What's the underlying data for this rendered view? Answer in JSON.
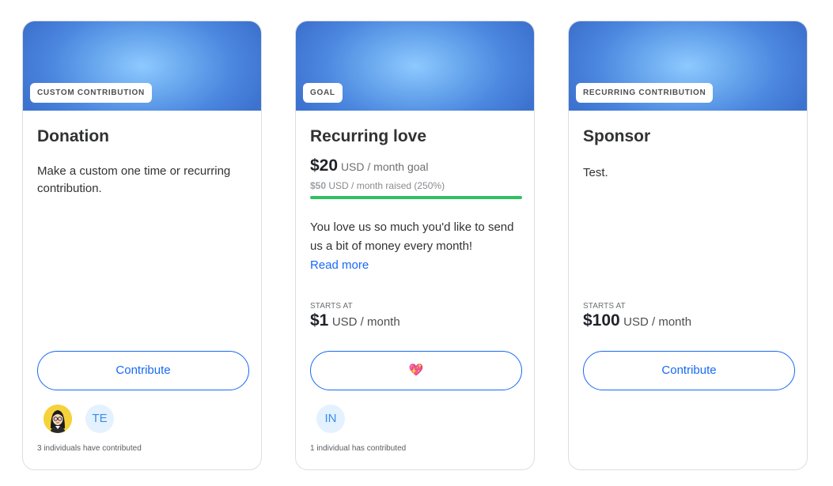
{
  "cards": [
    {
      "type_badge": "CUSTOM CONTRIBUTION",
      "title": "Donation",
      "description": "Make a custom one time or recurring contribution.",
      "button_label": "Contribute",
      "contributor_avatars": [
        {
          "kind": "photo"
        },
        {
          "kind": "initials",
          "initials": "TE"
        }
      ],
      "contributor_count_text": "3 individuals have contributed"
    },
    {
      "type_badge": "GOAL",
      "title": "Recurring love",
      "goal": {
        "amount": "$20",
        "unit": "USD / month goal",
        "raised_amount": "$50",
        "raised_text": "USD / month raised (250%)",
        "progress_percent": 100
      },
      "description": "You love us so much you'd like to send us a bit of money every month!",
      "read_more": "Read more",
      "starts_at_label": "STARTS AT",
      "starts_at_amount": "$1",
      "starts_at_unit": "USD / month",
      "button_label": "💖",
      "contributor_avatars": [
        {
          "kind": "initials",
          "initials": "IN"
        }
      ],
      "contributor_count_text": "1 individual has contributed"
    },
    {
      "type_badge": "RECURRING CONTRIBUTION",
      "title": "Sponsor",
      "description": "Test.",
      "starts_at_label": "STARTS AT",
      "starts_at_amount": "$100",
      "starts_at_unit": "USD / month",
      "button_label": "Contribute"
    }
  ],
  "colors": {
    "accent": "#1869f5",
    "progress": "#2fc061",
    "banner": "#4b86df"
  }
}
